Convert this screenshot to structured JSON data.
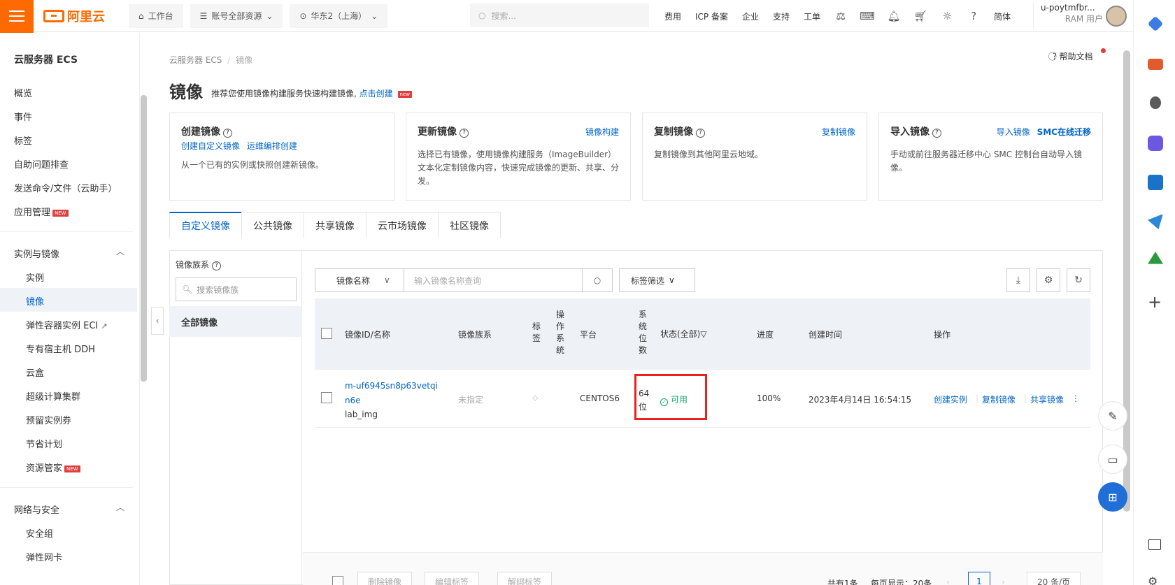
{
  "topbar": {
    "logo": "阿里云",
    "workbench": "工作台",
    "account_scope": "账号全部资源",
    "region": "华东2（上海）",
    "search_placeholder": "搜索...",
    "links": [
      "费用",
      "ICP 备案",
      "企业",
      "支持",
      "工单"
    ],
    "lang": "简体",
    "user_name": "u-poytmfbr...",
    "user_role": "RAM 用户"
  },
  "sidebar": {
    "title": "云服务器 ECS",
    "top_items": [
      "概览",
      "事件",
      "标签",
      "自助问题排查",
      "发送命令/文件（云助手）",
      "应用管理"
    ],
    "new_badge": "NEW",
    "group1": "实例与镜像",
    "group1_items": [
      "实例",
      "镜像",
      "弹性容器实例 ECI",
      "专有宿主机 DDH",
      "云盒",
      "超级计算集群",
      "预留实例券",
      "节省计划",
      "资源管家"
    ],
    "group2": "网络与安全",
    "group2_items": [
      "安全组",
      "弹性网卡"
    ]
  },
  "breadcrumb": {
    "root": "云服务器 ECS",
    "sep": "/",
    "current": "镜像"
  },
  "help": "帮助文档",
  "page": {
    "title": "镜像",
    "subtitle": "推荐您使用镜像构建服务快速构建镜像,",
    "subtitle_link": "点击创建",
    "new_badge": "new"
  },
  "cards": [
    {
      "title": "创建镜像",
      "links": [
        "创建自定义镜像",
        "运维编排创建"
      ],
      "desc": "从一个已有的实例或快照创建新镜像。"
    },
    {
      "title": "更新镜像",
      "links": [
        "镜像构建"
      ],
      "desc": "选择已有镜像，使用镜像构建服务（ImageBuilder）文本化定制镜像内容，快速完成镜像的更新、共享、分发。"
    },
    {
      "title": "复制镜像",
      "links": [
        "复制镜像"
      ],
      "desc": "复制镜像到其他阿里云地域。"
    },
    {
      "title": "导入镜像",
      "links": [
        "导入镜像",
        "SMC在线迁移"
      ],
      "desc": "手动或前往服务器迁移中心 SMC 控制台自动导入镜像。"
    }
  ],
  "tabs": [
    "自定义镜像",
    "公共镜像",
    "共享镜像",
    "云市场镜像",
    "社区镜像"
  ],
  "family": {
    "label": "镜像族系",
    "search_placeholder": "搜索镜像族",
    "all": "全部镜像"
  },
  "toolbar": {
    "select_value": "镜像名称",
    "search_placeholder": "输入镜像名称查询",
    "tag_filter": "标签筛选"
  },
  "table": {
    "headers": {
      "id_name": "镜像ID/名称",
      "family": "镜像族系",
      "tag": "标签",
      "os": "操作系统",
      "platform": "平台",
      "bits": "系统位数",
      "status": "状态(全部)",
      "progress": "进度",
      "created": "创建时间",
      "ops": "操作"
    },
    "rows": [
      {
        "id": "m-uf6945sn8p63vetqin6e",
        "name": "lab_img",
        "family": "未指定",
        "platform": "CENTOS6",
        "bits": "64位",
        "status": "可用",
        "progress": "100%",
        "created": "2023年4月14日 16:54:15",
        "ops": [
          "创建实例",
          "复制镜像",
          "共享镜像"
        ]
      }
    ]
  },
  "footer": {
    "buttons": [
      "删除镜像",
      "编辑标签",
      "解绑标签"
    ],
    "total": "共有1条",
    "per_page_text": "每页显示：20条",
    "page": "1",
    "page_size": "20 条/页"
  }
}
